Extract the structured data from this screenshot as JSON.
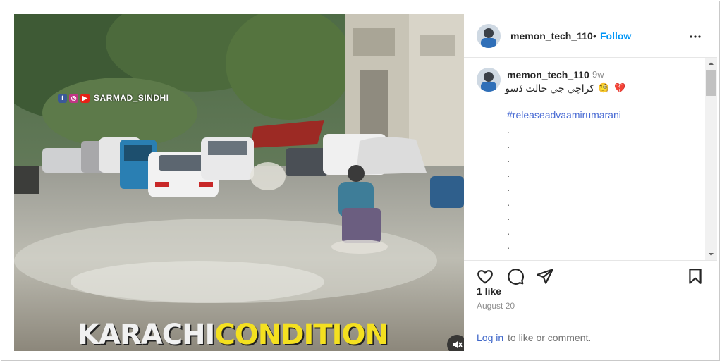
{
  "post": {
    "username": "memon_tech_110",
    "follow_label": "Follow",
    "separator": "•"
  },
  "media": {
    "watermark": "SARMAD_SINDHI",
    "overlay_word_1": "KARACHI",
    "overlay_word_2": "CONDITION"
  },
  "caption": {
    "username": "memon_tech_110",
    "time_ago": "9w",
    "text": "كراچي جي حالت ڏسو",
    "emoji_1": "🧐",
    "emoji_2": "💔",
    "hashtag": "#releaseadvaamirumarani",
    "dots": [
      ".",
      ".",
      ".",
      ".",
      ".",
      ".",
      ".",
      ".",
      "."
    ]
  },
  "stats": {
    "likes": "1 like",
    "date": "August 20"
  },
  "footer": {
    "login_label": "Log in",
    "login_suffix": "to like or comment."
  },
  "icons": [
    "heart-icon",
    "comment-icon",
    "share-icon",
    "bookmark-icon",
    "more-icon",
    "mute-icon"
  ],
  "colors": {
    "follow": "#0095f6",
    "hashtag": "#4a6cd4",
    "overlay_yellow": "#f4e020"
  }
}
